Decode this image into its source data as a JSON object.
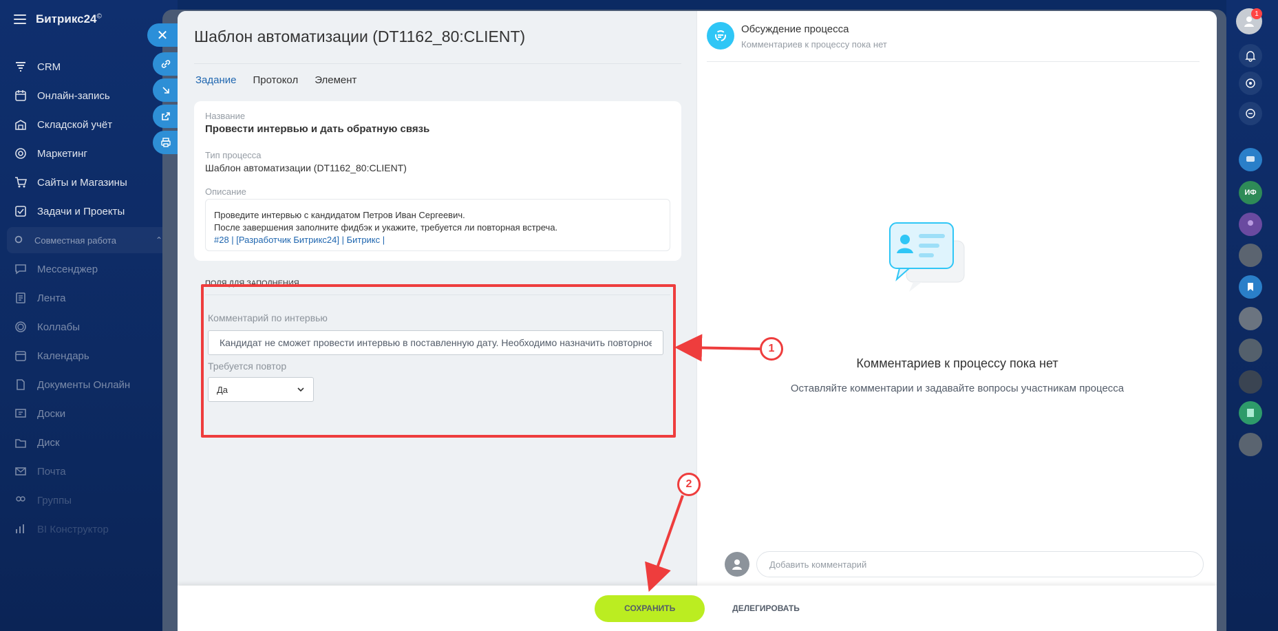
{
  "app": {
    "brand": "Битрикс24",
    "brand_mark": "©"
  },
  "sidebar": {
    "items": [
      {
        "label": "CRM",
        "icon": "funnel-icon"
      },
      {
        "label": "Онлайн-запись",
        "icon": "calendar-grid-icon"
      },
      {
        "label": "Складской учёт",
        "icon": "warehouse-icon"
      },
      {
        "label": "Маркетинг",
        "icon": "target-icon"
      },
      {
        "label": "Сайты и Магазины",
        "icon": "cart-icon"
      },
      {
        "label": "Задачи и Проекты",
        "icon": "checkbox-icon"
      }
    ],
    "group_label": "Совместная работа",
    "group_items": [
      {
        "label": "Мессенджер",
        "icon": "chat-icon"
      },
      {
        "label": "Лента",
        "icon": "feed-icon"
      },
      {
        "label": "Коллабы",
        "icon": "collab-icon"
      },
      {
        "label": "Календарь",
        "icon": "calendar-icon"
      },
      {
        "label": "Документы Онлайн",
        "icon": "document-icon"
      },
      {
        "label": "Доски",
        "icon": "board-icon"
      },
      {
        "label": "Диск",
        "icon": "disk-icon"
      },
      {
        "label": "Почта",
        "icon": "mail-icon"
      },
      {
        "label": "Группы",
        "icon": "groups-icon"
      },
      {
        "label": "BI Конструктор",
        "icon": "chart-icon"
      }
    ]
  },
  "slider": {
    "title": "Шаблон автоматизации (DT1162_80:CLIENT)",
    "tabs": [
      "Задание",
      "Протокол",
      "Элемент"
    ],
    "info": {
      "name_label": "Название",
      "name_value": "Провести интервью и дать обратную связь",
      "type_label": "Тип процесса",
      "type_value": "Шаблон автоматизации (DT1162_80:CLIENT)",
      "desc_label": "Описание",
      "desc_line1": "Проведите интервью с кандидатом Петров Иван Сергеевич.",
      "desc_line2": "После завершения заполните фидбэк и укажите, требуется ли повторная встреча.",
      "desc_link": "#28 | [Разработчик Битрикс24] | Битрикс |"
    },
    "fields": {
      "heading": "ПОЛЯ ДЛЯ ЗАПОЛНЕНИЯ",
      "comment_label": "Комментарий по интервью",
      "comment_value": "Кандидат не сможет провести интервью в поставленную дату. Необходимо назначить повторное",
      "repeat_label": "Требуется повтор",
      "repeat_value": "Да"
    },
    "discussion": {
      "title": "Обсуждение процесса",
      "subtitle": "Комментариев к процессу пока нет",
      "empty_title": "Комментариев к процессу пока нет",
      "empty_sub": "Оставляйте комментарии и задавайте вопросы участникам процесса",
      "comment_placeholder": "Добавить комментарий"
    },
    "footer": {
      "save": "СОХРАНИТЬ",
      "delegate": "ДЕЛЕГИРОВАТЬ"
    }
  },
  "right_bar": {
    "badge": "1",
    "initials": "ИФ"
  },
  "callouts": [
    "1",
    "2"
  ],
  "colors": {
    "accent": "#2067b0",
    "save_button": "#bbed21",
    "highlight": "#ee3d3d",
    "process_icon": "#2fc6f6"
  }
}
